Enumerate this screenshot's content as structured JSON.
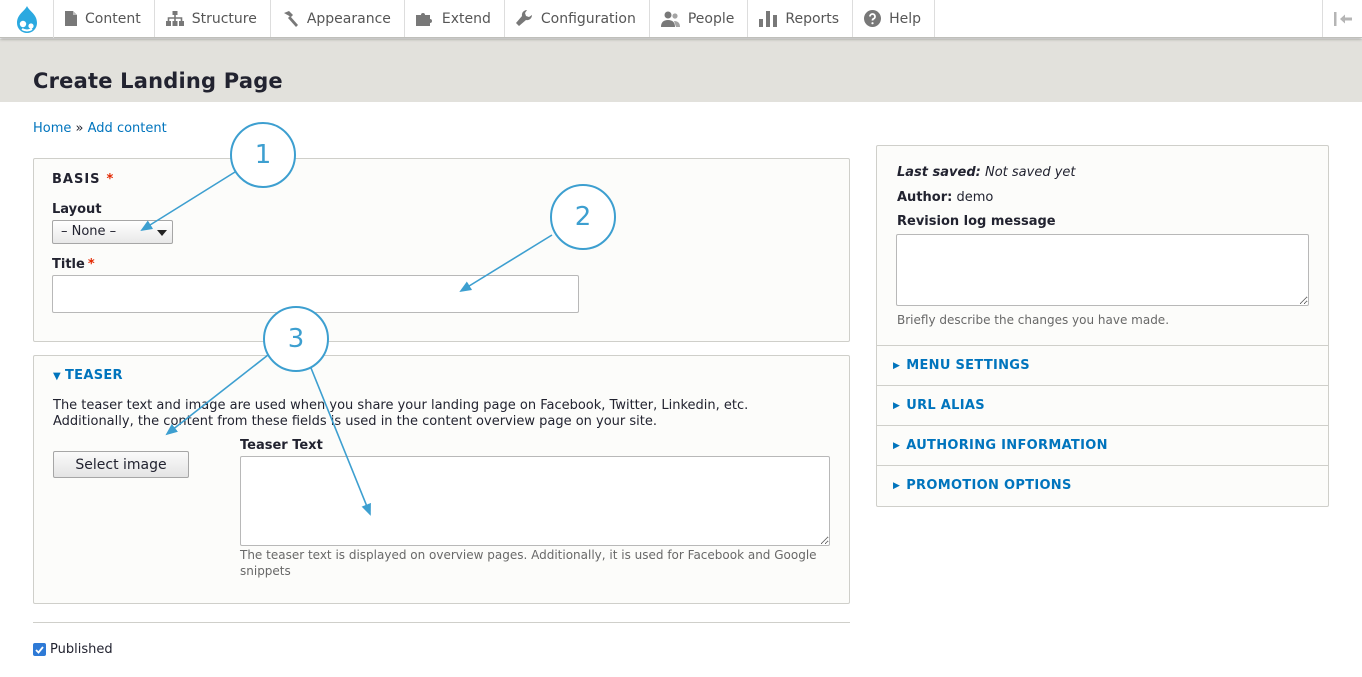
{
  "toolbar": {
    "items": [
      {
        "label": "Content",
        "icon": "document-icon"
      },
      {
        "label": "Structure",
        "icon": "sitemap-icon"
      },
      {
        "label": "Appearance",
        "icon": "paintbrush-icon"
      },
      {
        "label": "Extend",
        "icon": "puzzle-icon"
      },
      {
        "label": "Configuration",
        "icon": "wrench-icon"
      },
      {
        "label": "People",
        "icon": "people-icon"
      },
      {
        "label": "Reports",
        "icon": "bar-chart-icon"
      },
      {
        "label": "Help",
        "icon": "help-icon"
      }
    ]
  },
  "page": {
    "title": "Create Landing Page"
  },
  "breadcrumb": {
    "home": "Home",
    "separator": "»",
    "current": "Add content"
  },
  "basis": {
    "legend": "BASIS",
    "required_mark": "*",
    "layout_label": "Layout",
    "layout_value": "– None –",
    "title_label": "Title",
    "title_value": ""
  },
  "teaser": {
    "summary": "TEASER",
    "description": "The teaser text and image are used when you share your landing page on Facebook, Twitter, Linkedin, etc. Additionally, the content from these fields is used in the content overview page on your site.",
    "select_image_label": "Select image",
    "teaser_text_label": "Teaser Text",
    "teaser_text_value": "",
    "teaser_text_help": "The teaser text is displayed on overview pages. Additionally, it is used for Facebook and Google snippets"
  },
  "published": {
    "label": "Published",
    "checked": true
  },
  "sidebar": {
    "last_saved_label": "Last saved:",
    "last_saved_value": "Not saved yet",
    "author_label": "Author:",
    "author_value": "demo",
    "revision_label": "Revision log message",
    "revision_value": "",
    "revision_help": "Briefly describe the changes you have made.",
    "sections": [
      "MENU SETTINGS",
      "URL ALIAS",
      "AUTHORING INFORMATION",
      "PROMOTION OPTIONS"
    ]
  },
  "callouts": [
    "1",
    "2",
    "3"
  ],
  "colors": {
    "link": "#0074bd",
    "callout": "#3d9fd0",
    "required": "#e32700",
    "header_bg": "#e2e1dc"
  }
}
